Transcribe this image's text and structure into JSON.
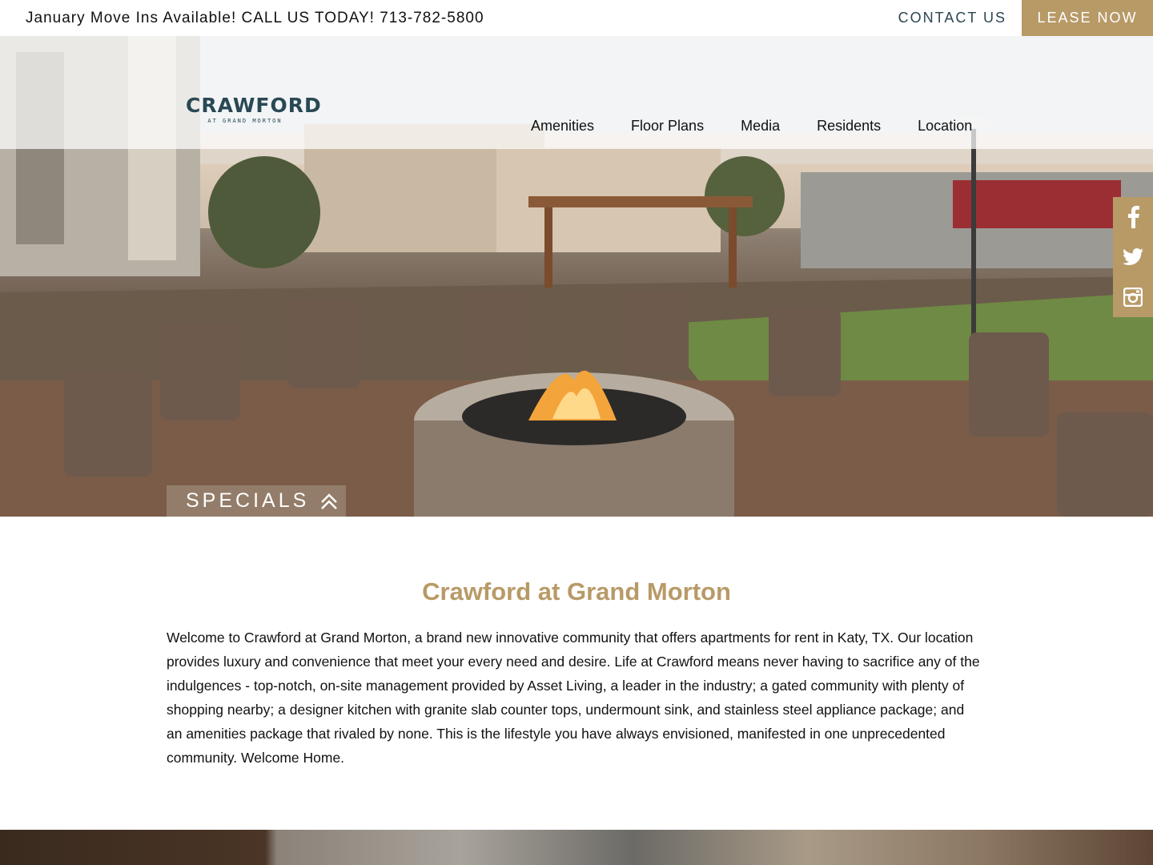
{
  "topbar": {
    "announcement": "January Move Ins Available! CALL US TODAY! 713-782-5800",
    "contact_label": "CONTACT US",
    "lease_label": "LEASE NOW"
  },
  "header": {
    "logo_main": "CRAWFORD",
    "logo_sub": "AT GRAND MORTON",
    "nav": [
      "Amenities",
      "Floor Plans",
      "Media",
      "Residents",
      "Location"
    ]
  },
  "social": [
    "facebook-icon",
    "twitter-icon",
    "instagram-icon"
  ],
  "hero": {
    "specials_label": "SPECIALS",
    "image_icon": "patio-firepit-photo"
  },
  "main": {
    "title": "Crawford at Grand Morton",
    "description": "Welcome to Crawford at Grand Morton, a brand new innovative community that offers apartments for rent in Katy, TX. Our location provides luxury and convenience that meet your every need and desire. Life at Crawford means never having to sacrifice any of the indulgences - top-notch, on-site management provided by Asset Living, a leader in the industry; a gated community with plenty of shopping nearby; a designer kitchen with granite slab counter tops, undermount sink, and stainless steel appliance package; and an amenities package that rivaled by none. This is the lifestyle you have always envisioned, manifested in one unprecedented community. Welcome Home."
  },
  "colors": {
    "accent": "#b89a67",
    "logo": "#294854",
    "contact": "#2c4650"
  }
}
